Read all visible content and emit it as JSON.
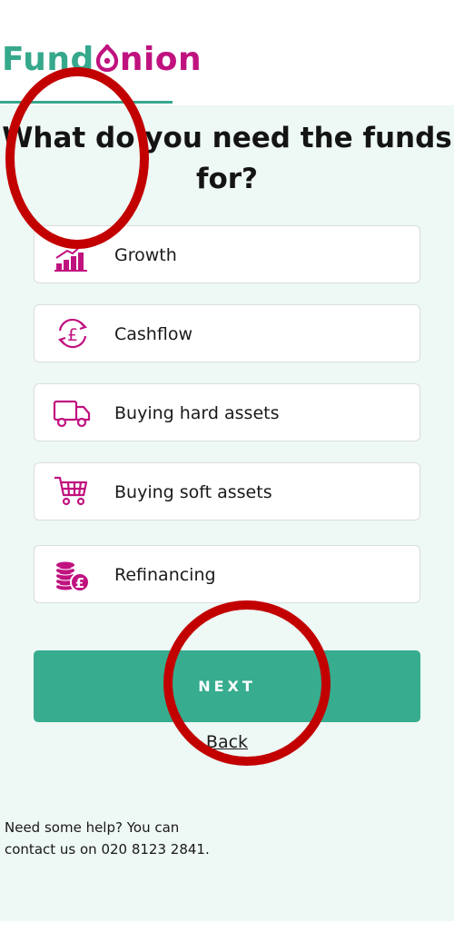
{
  "brand": {
    "logo_part1": "Fund",
    "logo_part2": "nion",
    "colors": {
      "teal": "#36a88c",
      "magenta": "#c0127f",
      "panel": "#eef8f5",
      "button": "#37ac8f",
      "annotation": "#c20000"
    }
  },
  "page": {
    "title": "What do you need the funds for?"
  },
  "options": [
    {
      "label": "Growth",
      "icon": "growth-chart-icon"
    },
    {
      "label": "Cashflow",
      "icon": "pound-cycle-icon"
    },
    {
      "label": "Buying hard assets",
      "icon": "truck-icon"
    },
    {
      "label": "Buying soft assets",
      "icon": "shopping-cart-icon"
    },
    {
      "label": "Refinancing",
      "icon": "coins-pound-icon"
    }
  ],
  "actions": {
    "next_label": "NEXT",
    "back_label": "Back"
  },
  "help": {
    "line1": "Need some help? You can",
    "line2": "contact us on 020 8123 2841."
  }
}
